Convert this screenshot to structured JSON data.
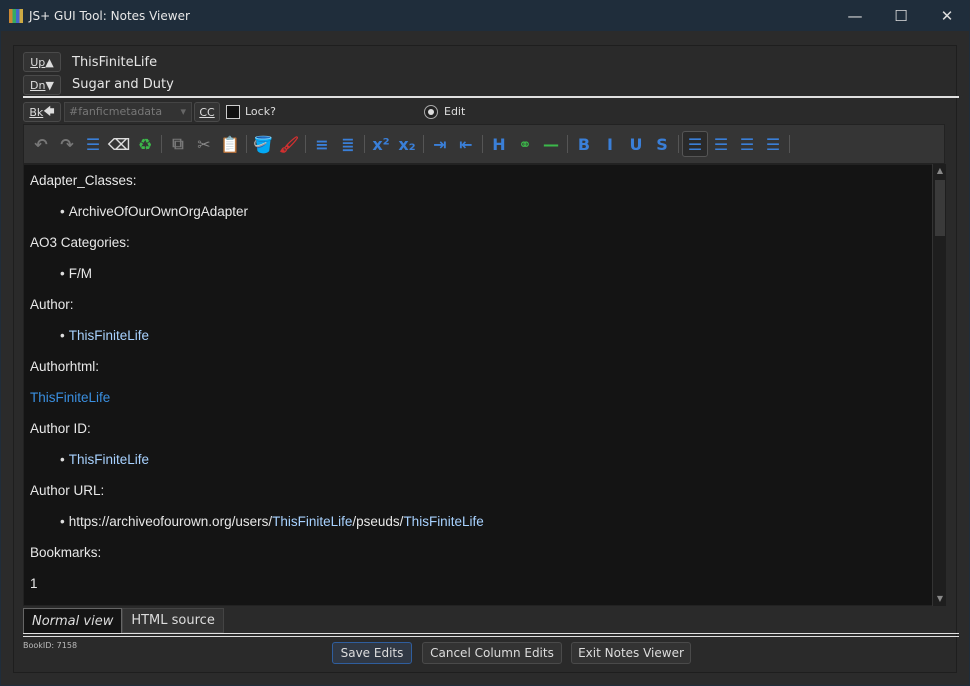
{
  "window": {
    "title": "JS+ GUI Tool:  Notes Viewer",
    "min": "—",
    "max": "☐",
    "close": "✕"
  },
  "nav": {
    "up_label": "Up",
    "up_arrow": "▲",
    "dn_label": "Dn",
    "dn_arrow": "▼",
    "author": "ThisFiniteLife",
    "title": "Sugar and Duty"
  },
  "controls": {
    "back_label": "Bk",
    "back_arrow": "🡄",
    "combo_value": "#fanficmetadata",
    "cc_label": "CC",
    "lock_label": "Lock?",
    "edit_label": "Edit"
  },
  "toolbar": [
    {
      "name": "undo-icon",
      "glyph": "↶",
      "color": "#777"
    },
    {
      "name": "redo-icon",
      "glyph": "↷",
      "color": "#777"
    },
    {
      "name": "select-all-icon",
      "glyph": "☰",
      "color": "#3a7fd8"
    },
    {
      "name": "eraser-icon",
      "glyph": "⌫",
      "color": "#ddd"
    },
    {
      "name": "recycle-icon",
      "glyph": "♻",
      "color": "#3cb84a"
    },
    {
      "sep": true
    },
    {
      "name": "copy-icon",
      "glyph": "⧉",
      "color": "#777"
    },
    {
      "name": "cut-icon",
      "glyph": "✂",
      "color": "#888"
    },
    {
      "name": "paste-icon",
      "glyph": "📋",
      "color": "#a0703a"
    },
    {
      "sep": true
    },
    {
      "name": "fill-color-icon",
      "glyph": "🪣",
      "color": "#c8a030"
    },
    {
      "name": "brush-icon",
      "glyph": "🖌",
      "color": "#d03030"
    },
    {
      "sep": true
    },
    {
      "name": "numbered-list-icon",
      "glyph": "≡",
      "color": "#3a7fd8"
    },
    {
      "name": "bullet-list-icon",
      "glyph": "≣",
      "color": "#3a7fd8"
    },
    {
      "sep": true
    },
    {
      "name": "superscript-icon",
      "glyph": "x²",
      "color": "#3a7fd8"
    },
    {
      "name": "subscript-icon",
      "glyph": "x₂",
      "color": "#3a7fd8"
    },
    {
      "sep": true
    },
    {
      "name": "indent-icon",
      "glyph": "⇥",
      "color": "#3a7fd8"
    },
    {
      "name": "outdent-icon",
      "glyph": "⇤",
      "color": "#3a7fd8"
    },
    {
      "sep": true
    },
    {
      "name": "heading-icon",
      "glyph": "H",
      "color": "#3a7fd8"
    },
    {
      "name": "link-icon",
      "glyph": "⚭",
      "color": "#3cb84a"
    },
    {
      "name": "horizontal-rule-icon",
      "glyph": "—",
      "color": "#3cb84a"
    },
    {
      "sep": true
    },
    {
      "name": "bold-icon",
      "glyph": "B",
      "color": "#3a7fd8"
    },
    {
      "name": "italic-icon",
      "glyph": "I",
      "color": "#3a7fd8"
    },
    {
      "name": "underline-icon",
      "glyph": "U",
      "color": "#3a7fd8"
    },
    {
      "name": "strikethrough-icon",
      "glyph": "S",
      "color": "#3a7fd8"
    },
    {
      "sep": true
    },
    {
      "name": "align-left-icon",
      "glyph": "☰",
      "color": "#3a7fd8",
      "active": true
    },
    {
      "name": "align-center-icon",
      "glyph": "☰",
      "color": "#3a7fd8"
    },
    {
      "name": "align-right-icon",
      "glyph": "☰",
      "color": "#3a7fd8"
    },
    {
      "name": "justify-icon",
      "glyph": "☰",
      "color": "#3a7fd8"
    },
    {
      "sep": true
    }
  ],
  "content": [
    {
      "type": "p",
      "text": "Adapter_Classes:"
    },
    {
      "type": "li",
      "text": "ArchiveOfOurOwnOrgAdapter"
    },
    {
      "type": "p",
      "text": "AO3 Categories:"
    },
    {
      "type": "li",
      "text": "F/M"
    },
    {
      "type": "p",
      "text": "Author:"
    },
    {
      "type": "li",
      "text": "ThisFiniteLife",
      "cls": "lb"
    },
    {
      "type": "p",
      "text": "Authorhtml:"
    },
    {
      "type": "p",
      "text": "ThisFiniteLife",
      "cls": "link"
    },
    {
      "type": "p",
      "text": "Author ID:"
    },
    {
      "type": "li",
      "text": "ThisFiniteLife",
      "cls": "lb"
    },
    {
      "type": "p",
      "text": "Author URL:"
    },
    {
      "type": "li",
      "parts": [
        {
          "t": "https://archiveofourown.org/users/"
        },
        {
          "t": "ThisFiniteLife",
          "cls": "lb"
        },
        {
          "t": "/pseuds/"
        },
        {
          "t": "ThisFiniteLife",
          "cls": "lb"
        }
      ]
    },
    {
      "type": "p",
      "text": "Bookmarks:"
    },
    {
      "type": "p",
      "text": "1"
    }
  ],
  "tabs": {
    "normal": "Normal view",
    "html": "HTML source"
  },
  "footer": {
    "book_id": "BookID: 7158",
    "save": "Save Edits",
    "cancel": "Cancel Column Edits",
    "exit": "Exit Notes Viewer"
  }
}
